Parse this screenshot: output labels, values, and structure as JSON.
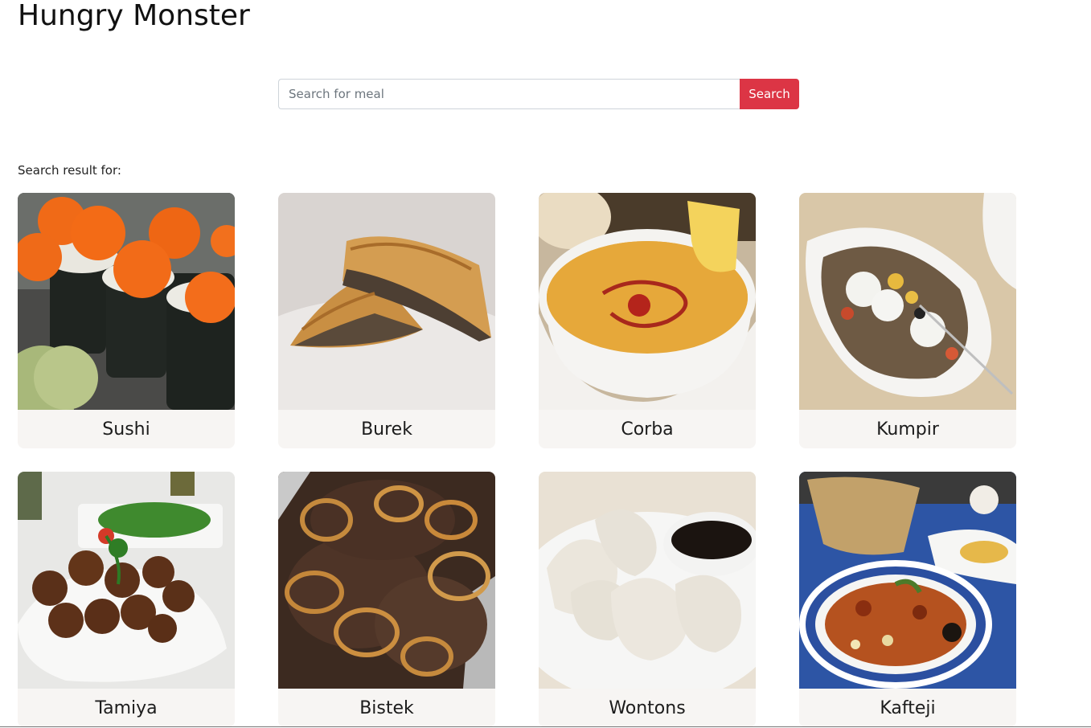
{
  "header": {
    "title": "Hungry Monster"
  },
  "search": {
    "placeholder": "Search for meal",
    "value": "",
    "button_label": "Search"
  },
  "results": {
    "label": "Search result for:",
    "meals": [
      {
        "name": "Sushi",
        "image": "sushi-photo"
      },
      {
        "name": "Burek",
        "image": "burek-photo"
      },
      {
        "name": "Corba",
        "image": "corba-photo"
      },
      {
        "name": "Kumpir",
        "image": "kumpir-photo"
      },
      {
        "name": "Tamiya",
        "image": "tamiya-photo"
      },
      {
        "name": "Bistek",
        "image": "bistek-photo"
      },
      {
        "name": "Wontons",
        "image": "wontons-photo"
      },
      {
        "name": "Kafteji",
        "image": "kafteji-photo"
      }
    ]
  },
  "colors": {
    "accent": "#dc3545",
    "card_background": "#f7f5f3"
  }
}
